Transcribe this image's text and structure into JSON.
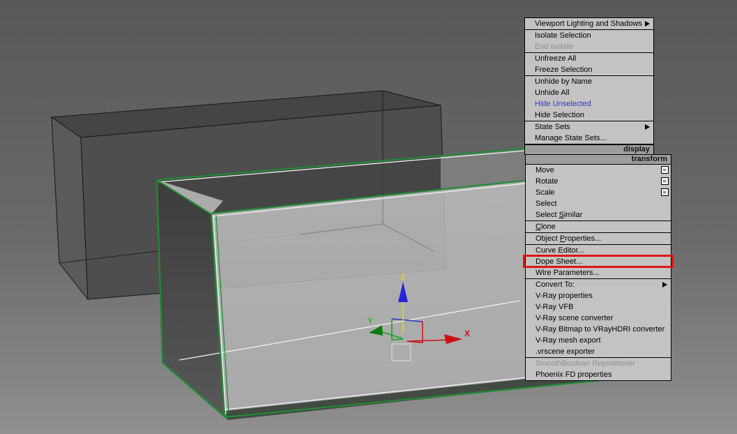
{
  "viewport": {
    "background_top": "#585858",
    "background_bottom": "#909090",
    "selection_edge_color": "#1f8c33",
    "gizmo": {
      "x_label": "X",
      "y_label": "Y",
      "z_label": "Z",
      "x_color": "#cc1111",
      "y_color": "#2db82d",
      "z_label_color": "#d8cc3a",
      "z_arrow_color": "#2525d8"
    }
  },
  "quad_menu": {
    "display": {
      "header": "display",
      "groups": [
        [
          {
            "label": "Viewport Lighting and Shadows",
            "submenu": true
          }
        ],
        [
          {
            "label": "Isolate Selection"
          },
          {
            "label": "End Isolate",
            "disabled": true
          }
        ],
        [
          {
            "label": "Unfreeze All"
          },
          {
            "label": "Freeze Selection"
          }
        ],
        [
          {
            "label": "Unhide by Name"
          },
          {
            "label": "Unhide All"
          },
          {
            "label": "Hide Unselected",
            "accent": true
          },
          {
            "label": "Hide Selection"
          }
        ],
        [
          {
            "label": "State Sets",
            "submenu": true
          },
          {
            "label": "Manage State Sets..."
          }
        ]
      ]
    },
    "transform": {
      "header": "transform",
      "groups": [
        [
          {
            "label": "Move",
            "settings": true
          },
          {
            "label": "Rotate",
            "settings": true
          },
          {
            "label": "Scale",
            "settings": true
          },
          {
            "label": "Select"
          },
          {
            "label": "Select &Similar"
          }
        ],
        [
          {
            "label": "&Clone"
          }
        ],
        [
          {
            "label": "Object &Properties..."
          }
        ],
        [
          {
            "label": "Curve Editor..."
          },
          {
            "label": "Dope Sheet...",
            "highlighted": true
          },
          {
            "label": "Wire Parameters..."
          }
        ],
        [
          {
            "label": "Convert To:",
            "submenu": true
          },
          {
            "label": "V-Ray properties"
          },
          {
            "label": "V-Ray VFB"
          },
          {
            "label": "V-Ray scene converter"
          },
          {
            "label": "V-Ray Bitmap to VRayHDRI converter"
          },
          {
            "label": "V-Ray mesh export"
          },
          {
            "label": ".vrscene exporter"
          }
        ],
        [
          {
            "label": "SmoothBoolean Repositioner",
            "disabled": true
          },
          {
            "label": "Phoenix FD properties"
          }
        ]
      ]
    },
    "annotation": {
      "highlighted_item": "Dope Sheet...",
      "highlight_color": "#de1515"
    }
  }
}
